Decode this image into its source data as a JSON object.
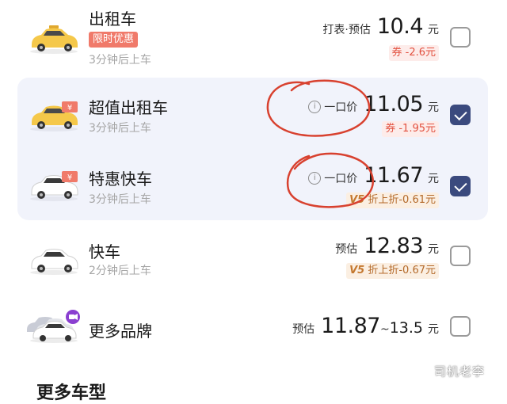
{
  "rides": [
    {
      "name": "出租车",
      "promo_tag": "限时优惠",
      "eta": "3分钟后上车",
      "price_prefix": "打表·预估",
      "price": "10.4",
      "unit": "元",
      "discount": "券 -2.6元",
      "checked": false,
      "car_color": "#f5c84a"
    },
    {
      "name": "超值出租车",
      "eta": "3分钟后上车",
      "price_prefix": "一口价",
      "price": "11.05",
      "unit": "元",
      "discount": "券 -1.95元",
      "checked": true,
      "car_color": "#f5c84a"
    },
    {
      "name": "特惠快车",
      "eta": "3分钟后上车",
      "price_prefix": "一口价",
      "price": "11.67",
      "unit": "元",
      "discount_badge": "V5",
      "discount": "折上折-0.61元",
      "checked": true,
      "car_color": "#ffffff"
    },
    {
      "name": "快车",
      "eta": "2分钟后上车",
      "price_prefix": "预估",
      "price": "12.83",
      "unit": "元",
      "discount_badge": "V5",
      "discount": "折上折-0.67元",
      "checked": false,
      "car_color": "#ffffff"
    },
    {
      "name": "更多品牌",
      "price_prefix": "预估",
      "price": "11.87",
      "price_sep": "~",
      "price_max": "13.5",
      "unit": "元",
      "checked": false,
      "car_color": "#ffffff"
    }
  ],
  "section_title": "更多车型",
  "watermark": "司机老李",
  "colors": {
    "accent": "#3b4a7e",
    "highlight_bg": "#f1f3fb",
    "coupon": "#e2503f",
    "annotation_circle": "#d8412f"
  },
  "icons": {
    "info": "info-icon",
    "check": "checkbox-check-icon"
  }
}
